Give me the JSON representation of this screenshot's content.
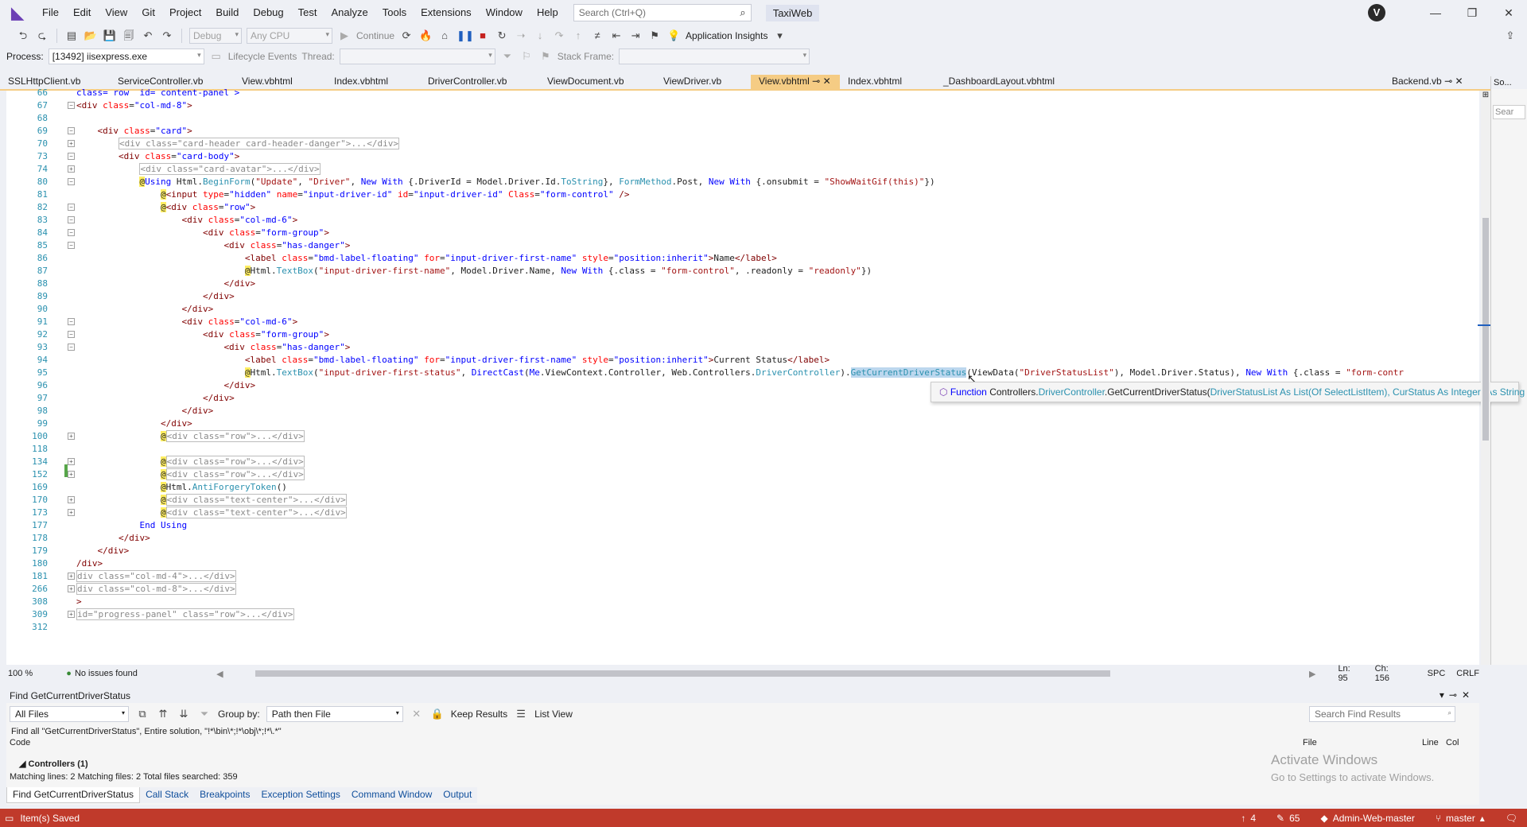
{
  "menubar": {
    "items": [
      "File",
      "Edit",
      "View",
      "Git",
      "Project",
      "Build",
      "Debug",
      "Test",
      "Analyze",
      "Tools",
      "Extensions",
      "Window",
      "Help"
    ],
    "search_placeholder": "Search (Ctrl+Q)",
    "solution_name": "TaxiWeb",
    "avatar_initial": "V"
  },
  "toolbar": {
    "config": "Debug",
    "platform": "Any CPU",
    "continue_label": "Continue",
    "insights_label": "Application Insights",
    "process_label": "Process:",
    "process_value": "[13492] iisexpress.exe",
    "lifecycle_label": "Lifecycle Events",
    "thread_label": "Thread:",
    "stackframe_label": "Stack Frame:"
  },
  "tabs": [
    {
      "label": "SSLHttpClient.vb",
      "active": false
    },
    {
      "label": "ServiceController.vb",
      "active": false
    },
    {
      "label": "View.vbhtml",
      "active": false
    },
    {
      "label": "Index.vbhtml",
      "active": false
    },
    {
      "label": "DriverController.vb",
      "active": false
    },
    {
      "label": "ViewDocument.vb",
      "active": false
    },
    {
      "label": "ViewDriver.vb",
      "active": false
    },
    {
      "label": "View.vbhtml",
      "active": true
    },
    {
      "label": "Index.vbhtml",
      "active": false
    },
    {
      "label": "_DashboardLayout.vbhtml",
      "active": false
    }
  ],
  "pinned_tab": "Backend.vb",
  "right_panel_label": "So...",
  "right_panel_search": "Sear",
  "line_numbers": [
    "66",
    "67",
    "68",
    "69",
    "70",
    "73",
    "74",
    "80",
    "81",
    "82",
    "83",
    "84",
    "85",
    "86",
    "87",
    "88",
    "89",
    "90",
    "91",
    "92",
    "93",
    "94",
    "95",
    "96",
    "97",
    "98",
    "99",
    "100",
    "118",
    "134",
    "152",
    "169",
    "170",
    "173",
    "177",
    "178",
    "179",
    "180",
    "181",
    "266",
    "308",
    "309",
    "312"
  ],
  "tooltip": {
    "kind": "Function",
    "namespace": "Controllers.",
    "class": "DriverController",
    "method": ".GetCurrentDriverStatus(",
    "param1": "DriverStatusList As ",
    "list_type": "List",
    "of": "(Of ",
    "selectitem": "SelectListItem",
    "rest": "), CurStatus As Integer) As String"
  },
  "editor_status": {
    "zoom": "100 %",
    "issues": "No issues found",
    "line": "Ln: 95",
    "col": "Ch: 156",
    "spc": "SPC",
    "crlf": "CRLF"
  },
  "find_panel": {
    "title": "Find GetCurrentDriverStatus",
    "scope": "All Files",
    "group_by_label": "Group by:",
    "group_by_value": "Path then File",
    "keep_results": "Keep Results",
    "list_view": "List View",
    "search_placeholder": "Search Find Results",
    "query_text": "Find all \"GetCurrentDriverStatus\", Entire solution, \"!*\\bin\\*;!*\\obj\\*;!*\\.*\"",
    "col_code": "Code",
    "col_file": "File",
    "col_line": "Line",
    "col_col": "Col",
    "group_row": "Controllers (1)",
    "summary": "Matching lines: 2 Matching files: 2 Total files searched: 359"
  },
  "watermark": {
    "title": "Activate Windows",
    "subtitle": "Go to Settings to activate Windows."
  },
  "bottom_tabs": [
    "Find GetCurrentDriverStatus",
    "Call Stack",
    "Breakpoints",
    "Exception Settings",
    "Command Window",
    "Output"
  ],
  "statusbar": {
    "message": "Item(s) Saved",
    "up_count": "4",
    "edit_count": "65",
    "repo": "Admin-Web-master",
    "branch": "master"
  },
  "colors": {
    "status_bar": "#c03a2b",
    "active_tab": "#f5cc84",
    "line_numbers": "#2b91af"
  }
}
